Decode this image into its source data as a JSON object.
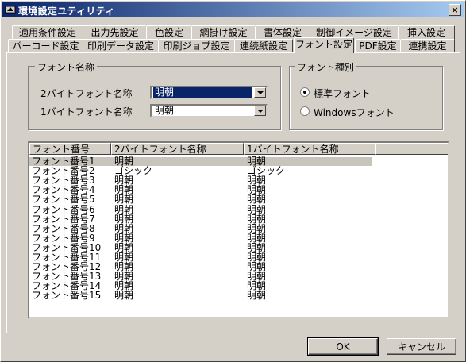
{
  "window": {
    "title": "環境設定ユティリティ",
    "close_label": "×"
  },
  "tabs_row1": [
    {
      "label": "適用条件設定"
    },
    {
      "label": "出力先設定"
    },
    {
      "label": "色設定"
    },
    {
      "label": "網掛け設定"
    },
    {
      "label": "書体設定"
    },
    {
      "label": "制御イメージ設定"
    },
    {
      "label": "挿入設定"
    }
  ],
  "tabs_row2": [
    {
      "label": "バーコード設定"
    },
    {
      "label": "印刷データ設定"
    },
    {
      "label": "印刷ジョブ設定"
    },
    {
      "label": "連続紙設定"
    },
    {
      "label": "フォント設定",
      "active": true
    },
    {
      "label": "PDF設定"
    },
    {
      "label": "連携設定"
    }
  ],
  "font_name_group": {
    "title": "フォント名称",
    "double_byte_label": "2バイトフォント名称",
    "double_byte_value": "明朝",
    "single_byte_label": "1バイトフォント名称",
    "single_byte_value": "明朝"
  },
  "font_type_group": {
    "title": "フォント種別",
    "options": [
      {
        "label": "標準フォント",
        "checked": true
      },
      {
        "label": "Windowsフォント",
        "checked": false
      }
    ]
  },
  "font_list": {
    "columns": [
      "フォント番号",
      "2バイトフォント名称",
      "1バイトフォント名称"
    ],
    "rows": [
      [
        "フォント番号1",
        "明朝",
        "明朝"
      ],
      [
        "フォント番号2",
        "ゴシック",
        "ゴシック"
      ],
      [
        "フォント番号3",
        "明朝",
        "明朝"
      ],
      [
        "フォント番号4",
        "明朝",
        "明朝"
      ],
      [
        "フォント番号5",
        "明朝",
        "明朝"
      ],
      [
        "フォント番号6",
        "明朝",
        "明朝"
      ],
      [
        "フォント番号7",
        "明朝",
        "明朝"
      ],
      [
        "フォント番号8",
        "明朝",
        "明朝"
      ],
      [
        "フォント番号9",
        "明朝",
        "明朝"
      ],
      [
        "フォント番号10",
        "明朝",
        "明朝"
      ],
      [
        "フォント番号11",
        "明朝",
        "明朝"
      ],
      [
        "フォント番号12",
        "明朝",
        "明朝"
      ],
      [
        "フォント番号13",
        "明朝",
        "明朝"
      ],
      [
        "フォント番号14",
        "明朝",
        "明朝"
      ],
      [
        "フォント番号15",
        "明朝",
        "明朝"
      ]
    ],
    "selected_index": 0
  },
  "buttons": {
    "ok": "OK",
    "cancel": "キャンセル"
  },
  "colors": {
    "titlebar_start": "#0a246a",
    "titlebar_end": "#a6caf0",
    "face": "#d4d0c8",
    "selection": "#0a246a"
  }
}
